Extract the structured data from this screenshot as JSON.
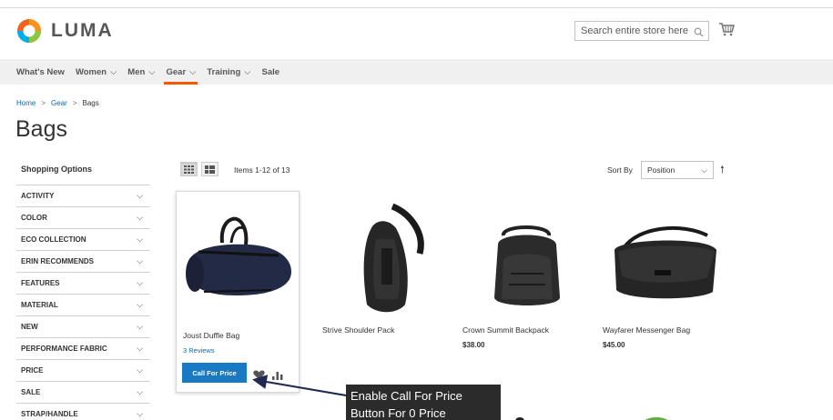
{
  "header": {
    "logo_text": "LUMA",
    "search_placeholder": "Search entire store here...",
    "brand_color": "#f26322"
  },
  "nav": {
    "items": [
      {
        "label": "What's New",
        "has_submenu": false
      },
      {
        "label": "Women",
        "has_submenu": true
      },
      {
        "label": "Men",
        "has_submenu": true
      },
      {
        "label": "Gear",
        "has_submenu": true,
        "active": true
      },
      {
        "label": "Training",
        "has_submenu": true
      },
      {
        "label": "Sale",
        "has_submenu": false
      }
    ],
    "active_color": "#ff5501"
  },
  "breadcrumb": [
    {
      "label": "Home"
    },
    {
      "label": ">"
    },
    {
      "label": "Gear"
    },
    {
      "label": ">"
    },
    {
      "label": "Bags"
    }
  ],
  "page_title": "Bags",
  "sidebar": {
    "title": "Shopping Options",
    "filters": [
      "ACTIVITY",
      "COLOR",
      "ECO COLLECTION",
      "ERIN RECOMMENDS",
      "FEATURES",
      "MATERIAL",
      "NEW",
      "PERFORMANCE FABRIC",
      "PRICE",
      "SALE",
      "STRAP/HANDLE"
    ]
  },
  "toolbar": {
    "amount": "Items 1-12 of 13",
    "sort_label": "Sort By",
    "sort_value": "Position"
  },
  "products": [
    {
      "name": "Joust Duffle Bag",
      "reviews": "3 Reviews",
      "price": "",
      "button": "Call For Price"
    },
    {
      "name": "Strive Shoulder Pack",
      "price": ""
    },
    {
      "name": "Crown Summit Backpack",
      "price": "$38.00"
    },
    {
      "name": "Wayfarer Messenger Bag",
      "price": "$45.00"
    }
  ],
  "callout": {
    "line1": "Enable Call For Price",
    "line2": "Button For 0 Price"
  },
  "colors": {
    "button": "#1979c3",
    "link": "#006bb4"
  }
}
